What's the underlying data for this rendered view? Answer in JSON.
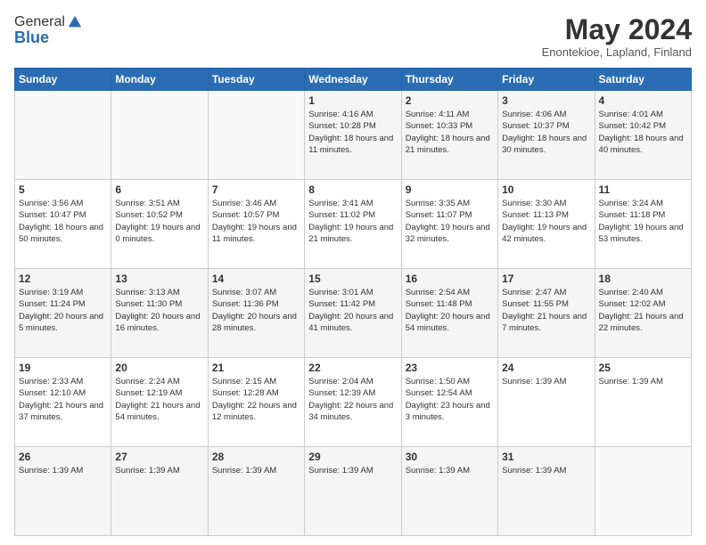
{
  "logo": {
    "general": "General",
    "blue": "Blue"
  },
  "header": {
    "month_title": "May 2024",
    "location": "Enontekioe, Lapland, Finland"
  },
  "weekdays": [
    "Sunday",
    "Monday",
    "Tuesday",
    "Wednesday",
    "Thursday",
    "Friday",
    "Saturday"
  ],
  "weeks": [
    [
      {
        "day": "",
        "info": ""
      },
      {
        "day": "",
        "info": ""
      },
      {
        "day": "",
        "info": ""
      },
      {
        "day": "1",
        "info": "Sunrise: 4:16 AM\nSunset: 10:28 PM\nDaylight: 18 hours\nand 11 minutes."
      },
      {
        "day": "2",
        "info": "Sunrise: 4:11 AM\nSunset: 10:33 PM\nDaylight: 18 hours\nand 21 minutes."
      },
      {
        "day": "3",
        "info": "Sunrise: 4:06 AM\nSunset: 10:37 PM\nDaylight: 18 hours\nand 30 minutes."
      },
      {
        "day": "4",
        "info": "Sunrise: 4:01 AM\nSunset: 10:42 PM\nDaylight: 18 hours\nand 40 minutes."
      }
    ],
    [
      {
        "day": "5",
        "info": "Sunrise: 3:56 AM\nSunset: 10:47 PM\nDaylight: 18 hours\nand 50 minutes."
      },
      {
        "day": "6",
        "info": "Sunrise: 3:51 AM\nSunset: 10:52 PM\nDaylight: 19 hours\nand 0 minutes."
      },
      {
        "day": "7",
        "info": "Sunrise: 3:46 AM\nSunset: 10:57 PM\nDaylight: 19 hours\nand 11 minutes."
      },
      {
        "day": "8",
        "info": "Sunrise: 3:41 AM\nSunset: 11:02 PM\nDaylight: 19 hours\nand 21 minutes."
      },
      {
        "day": "9",
        "info": "Sunrise: 3:35 AM\nSunset: 11:07 PM\nDaylight: 19 hours\nand 32 minutes."
      },
      {
        "day": "10",
        "info": "Sunrise: 3:30 AM\nSunset: 11:13 PM\nDaylight: 19 hours\nand 42 minutes."
      },
      {
        "day": "11",
        "info": "Sunrise: 3:24 AM\nSunset: 11:18 PM\nDaylight: 19 hours\nand 53 minutes."
      }
    ],
    [
      {
        "day": "12",
        "info": "Sunrise: 3:19 AM\nSunset: 11:24 PM\nDaylight: 20 hours\nand 5 minutes."
      },
      {
        "day": "13",
        "info": "Sunrise: 3:13 AM\nSunset: 11:30 PM\nDaylight: 20 hours\nand 16 minutes."
      },
      {
        "day": "14",
        "info": "Sunrise: 3:07 AM\nSunset: 11:36 PM\nDaylight: 20 hours\nand 28 minutes."
      },
      {
        "day": "15",
        "info": "Sunrise: 3:01 AM\nSunset: 11:42 PM\nDaylight: 20 hours\nand 41 minutes."
      },
      {
        "day": "16",
        "info": "Sunrise: 2:54 AM\nSunset: 11:48 PM\nDaylight: 20 hours\nand 54 minutes."
      },
      {
        "day": "17",
        "info": "Sunrise: 2:47 AM\nSunset: 11:55 PM\nDaylight: 21 hours\nand 7 minutes."
      },
      {
        "day": "18",
        "info": "Sunrise: 2:40 AM\nSunset: 12:02 AM\nDaylight: 21 hours\nand 22 minutes."
      }
    ],
    [
      {
        "day": "19",
        "info": "Sunrise: 2:33 AM\nSunset: 12:10 AM\nDaylight: 21 hours\nand 37 minutes."
      },
      {
        "day": "20",
        "info": "Sunrise: 2:24 AM\nSunset: 12:19 AM\nDaylight: 21 hours\nand 54 minutes."
      },
      {
        "day": "21",
        "info": "Sunrise: 2:15 AM\nSunset: 12:28 AM\nDaylight: 22 hours\nand 12 minutes."
      },
      {
        "day": "22",
        "info": "Sunrise: 2:04 AM\nSunset: 12:39 AM\nDaylight: 22 hours\nand 34 minutes."
      },
      {
        "day": "23",
        "info": "Sunrise: 1:50 AM\nSunset: 12:54 AM\nDaylight: 23 hours\nand 3 minutes."
      },
      {
        "day": "24",
        "info": "Sunrise: 1:39 AM"
      },
      {
        "day": "25",
        "info": "Sunrise: 1:39 AM"
      }
    ],
    [
      {
        "day": "26",
        "info": "Sunrise: 1:39 AM"
      },
      {
        "day": "27",
        "info": "Sunrise: 1:39 AM"
      },
      {
        "day": "28",
        "info": "Sunrise: 1:39 AM"
      },
      {
        "day": "29",
        "info": "Sunrise: 1:39 AM"
      },
      {
        "day": "30",
        "info": "Sunrise: 1:39 AM"
      },
      {
        "day": "31",
        "info": "Sunrise: 1:39 AM"
      },
      {
        "day": "",
        "info": ""
      }
    ]
  ]
}
